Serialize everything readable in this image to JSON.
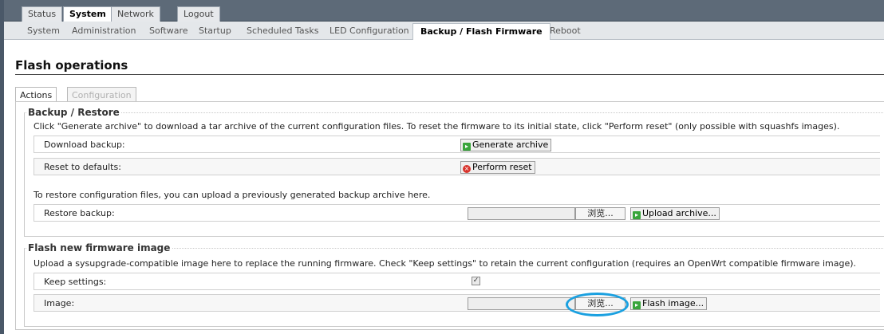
{
  "top_menu": [
    {
      "label": "Status",
      "active": false
    },
    {
      "label": "System",
      "active": true
    },
    {
      "label": "Network",
      "active": false
    },
    {
      "label": "Logout",
      "active": false
    }
  ],
  "sub_menu": [
    "System",
    "Administration",
    "Software",
    "Startup",
    "Scheduled Tasks",
    "LED Configuration",
    "Backup / Flash Firmware",
    "Reboot"
  ],
  "page_title": "Flash operations",
  "content_tabs": {
    "actions": "Actions",
    "configuration": "Configuration"
  },
  "backup": {
    "legend": "Backup / Restore",
    "description": "Click \"Generate archive\" to download a tar archive of the current configuration files. To reset the firmware to its initial state, click \"Perform reset\" (only possible with squashfs images).",
    "download_label": "Download backup:",
    "generate_button": "Generate archive",
    "reset_label": "Reset to defaults:",
    "reset_button": "Perform reset",
    "restore_description": "To restore configuration files, you can upload a previously generated backup archive here.",
    "restore_label": "Restore backup:",
    "browse_button": "浏览...",
    "upload_button": "Upload archive..."
  },
  "flash": {
    "legend": "Flash new firmware image",
    "description": "Upload a sysupgrade-compatible image here to replace the running firmware. Check \"Keep settings\" to retain the current configuration (requires an OpenWrt compatible firmware image).",
    "keep_label": "Keep settings:",
    "keep_checked": true,
    "image_label": "Image:",
    "browse_button": "浏览...",
    "flash_button": "Flash image..."
  },
  "colors": {
    "header": "#5d6a78",
    "highlight": "#1aa0e0",
    "go_icon": "#39a53c",
    "stop_icon": "#d8332b"
  }
}
